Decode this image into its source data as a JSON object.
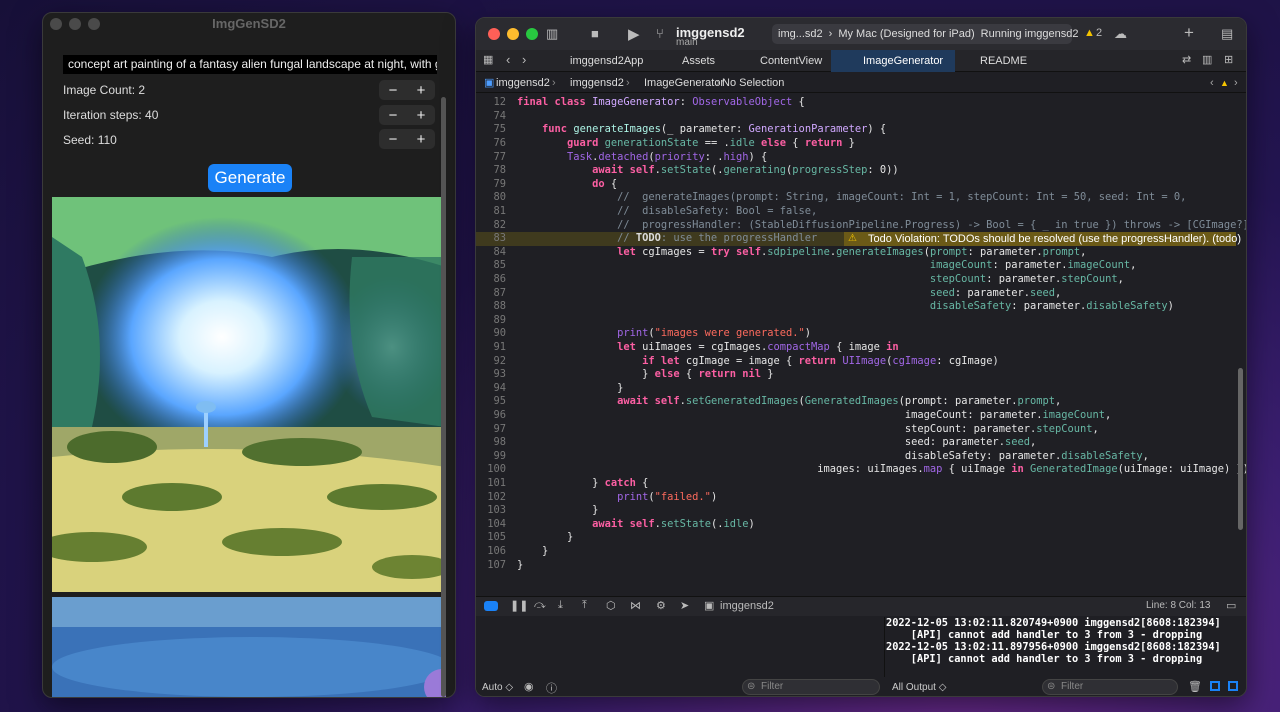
{
  "app": {
    "title": "ImgGenSD2",
    "prompt": "concept art painting of a fantasy alien fungal landscape at night, with glowin...",
    "image_count_label": "Image Count: 2",
    "iteration_label": "Iteration steps: 40",
    "seed_label": "Seed: 110",
    "minus": "−",
    "plus": "+",
    "generate_label": "Generate"
  },
  "xcode": {
    "scheme": "imggensd2",
    "branch": "main",
    "target": "img...sd2",
    "destination": "My Mac (Designed for iPad)",
    "status": "Running imggensd2",
    "warning_count": "2",
    "tabs": [
      "imggensd2App",
      "Assets",
      "ContentView",
      "ImageGenerator",
      "README"
    ],
    "breadcrumbs": [
      "imggensd2",
      "imggensd2",
      "ImageGenerator",
      "No Selection"
    ],
    "line_numbers": [
      "12",
      "74",
      "75",
      "76",
      "77",
      "78",
      "79",
      "80",
      "81",
      "82",
      "83",
      "84",
      "85",
      "86",
      "87",
      "88",
      "89",
      "90",
      "91",
      "92",
      "93",
      "94",
      "95",
      "96",
      "97",
      "98",
      "99",
      "100",
      "101",
      "102",
      "103",
      "104",
      "105",
      "106",
      "107"
    ],
    "todo_warning": "Todo Violation: TODOs should be resolved (use the progressHandler). (todo)",
    "cursor": "Line: 8  Col: 13",
    "debug_target": "imggensd2",
    "console_lines": [
      "2022-12-05 13:02:11.820749+0900 imggensd2[8608:182394]",
      "    [API] cannot add handler to 3 from 3 - dropping",
      "2022-12-05 13:02:11.897956+0900 imggensd2[8608:182394]",
      "    [API] cannot add handler to 3 from 3 - dropping"
    ],
    "auto_label": "Auto ◇",
    "filter_placeholder": "Filter",
    "output_label": "All Output ◇"
  }
}
